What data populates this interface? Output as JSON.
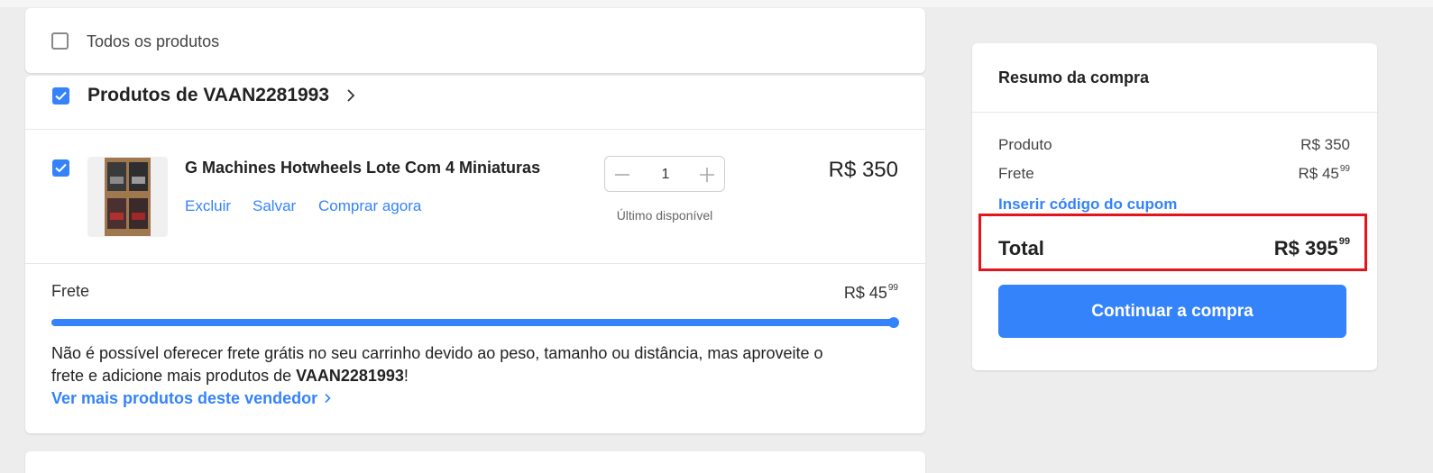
{
  "select_all": {
    "label": "Todos os produtos",
    "checked": false
  },
  "seller": {
    "title": "Produtos de VAAN2281993",
    "checked": true
  },
  "item": {
    "title": "G Machines Hotwheels Lote Com 4 Miniaturas",
    "actions": {
      "remove": "Excluir",
      "save": "Salvar",
      "buy_now": "Comprar agora"
    },
    "quantity": "1",
    "stock_note": "Último disponível",
    "price": "R$ 350",
    "checked": true
  },
  "shipping": {
    "label": "Frete",
    "price_main": "R$ 45",
    "price_cents": "99",
    "progress": 1.0,
    "message_part1": "Não é possível oferecer frete grátis no seu carrinho devido ao peso, tamanho ou distância, mas aproveite o frete e adicione mais produtos de ",
    "message_seller": "VAAN2281993",
    "message_end": "!",
    "more_link": "Ver mais produtos deste vendedor"
  },
  "summary": {
    "title": "Resumo da compra",
    "product_label": "Produto",
    "product_value": "R$ 350",
    "shipping_label": "Frete",
    "shipping_main": "R$ 45",
    "shipping_cents": "99",
    "coupon_link": "Inserir código do cupom",
    "total_label": "Total",
    "total_main": "R$ 395",
    "total_cents": "99",
    "continue_button": "Continuar a compra"
  },
  "colors": {
    "accent": "#3483fa",
    "highlight": "#e3141c"
  },
  "icons": {
    "decrement": "minus-icon",
    "increment": "plus-icon",
    "seller_link": "chevron-right-icon",
    "more_link": "chevron-right-icon"
  }
}
